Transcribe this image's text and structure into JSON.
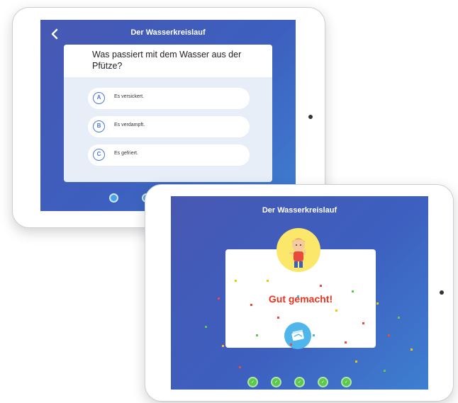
{
  "quiz_screen": {
    "title": "Der Wasserkreislauf",
    "question": "Was passiert mit dem Wasser aus der Pfütze?",
    "answers": [
      {
        "letter": "A",
        "text": "Es versickert."
      },
      {
        "letter": "B",
        "text": "Es verdampft."
      },
      {
        "letter": "C",
        "text": "Es gefriert."
      }
    ],
    "icons": {
      "back": "chevron-left-icon"
    }
  },
  "result_screen": {
    "title": "Der Wasserkreislauf",
    "message": "Gut gemacht!",
    "icons": {
      "restart": "restart-icon",
      "avatar": "child-avatar-icon"
    }
  },
  "colors": {
    "screen_bg": "#4758b3",
    "accent_blue": "#4a78d6",
    "success_green": "#5cc84d",
    "result_red": "#e8331d",
    "avatar_yellow": "#fbe86a"
  }
}
